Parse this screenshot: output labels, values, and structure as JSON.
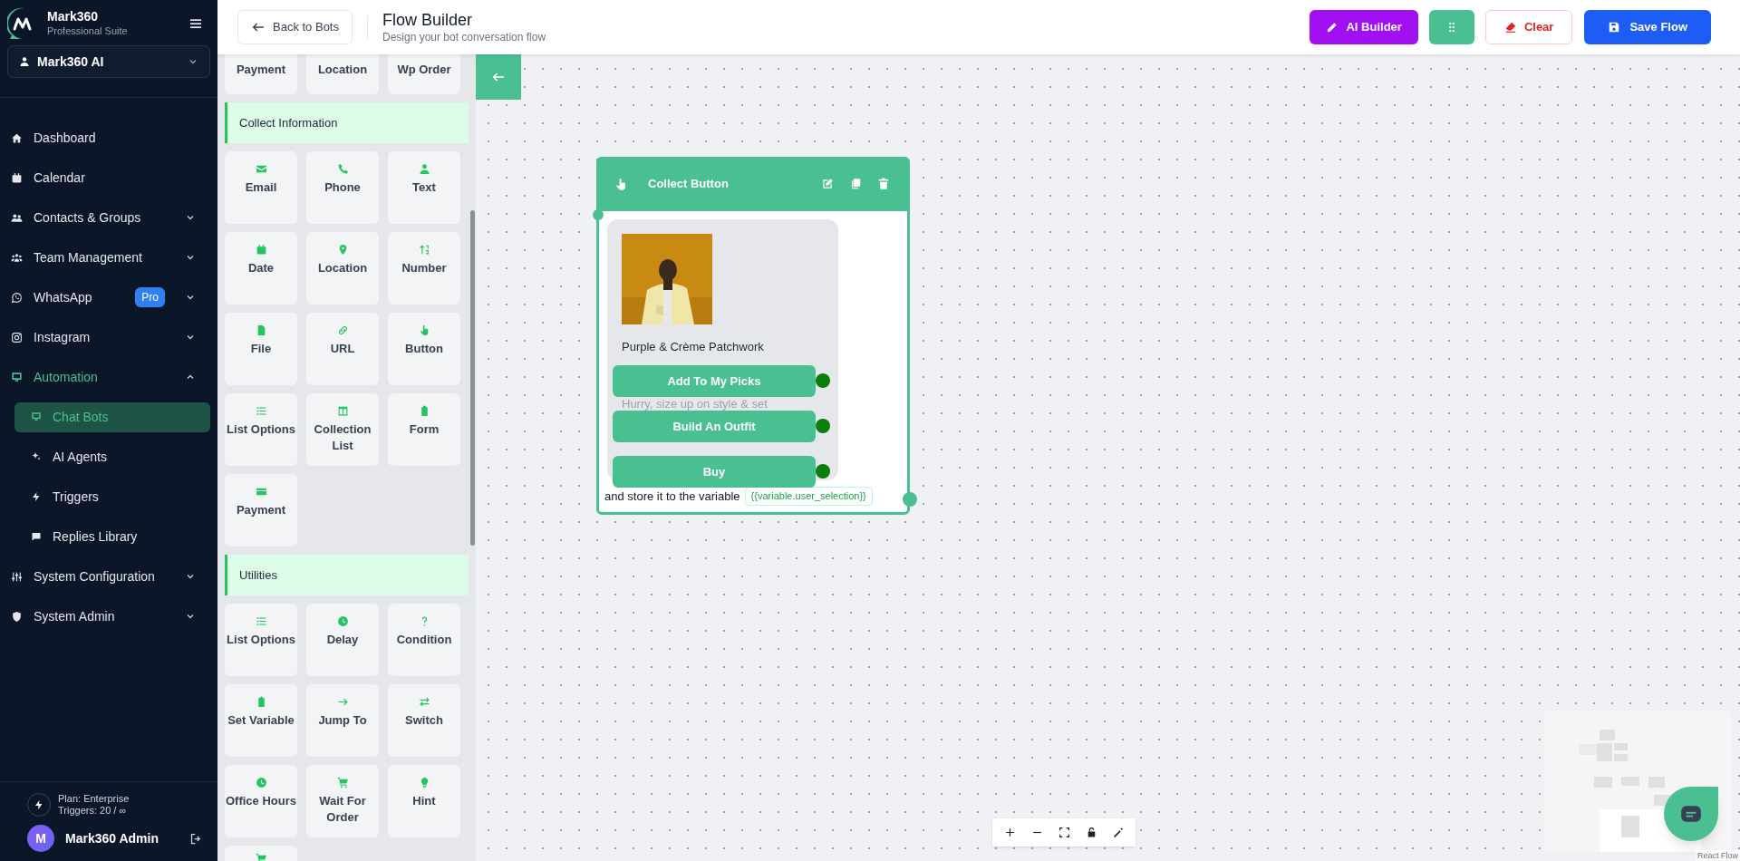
{
  "sidebar": {
    "brand": {
      "name": "Mark360",
      "subtitle": "Professional Suite"
    },
    "workspace": {
      "label": "Mark360 AI"
    },
    "nav": [
      {
        "label": "Dashboard",
        "kind": "link",
        "selected": false
      },
      {
        "label": "Calendar",
        "kind": "link",
        "selected": false
      },
      {
        "label": "Contacts & Groups",
        "kind": "group",
        "expanded": false,
        "selected": false
      },
      {
        "label": "Team Management",
        "kind": "group",
        "expanded": false,
        "selected": false
      },
      {
        "label": "WhatsApp",
        "kind": "group",
        "expanded": false,
        "selected": false,
        "badge": "Pro"
      },
      {
        "label": "Instagram",
        "kind": "group",
        "expanded": false,
        "selected": false
      },
      {
        "label": "Automation",
        "kind": "group",
        "expanded": true,
        "selected": false,
        "children": [
          {
            "label": "Chat Bots",
            "selected": true
          },
          {
            "label": "AI Agents",
            "selected": false
          },
          {
            "label": "Triggers",
            "selected": false
          },
          {
            "label": "Replies Library",
            "selected": false
          }
        ]
      },
      {
        "label": "System Configuration",
        "kind": "group",
        "expanded": false,
        "selected": false
      },
      {
        "label": "System Admin",
        "kind": "group",
        "expanded": false,
        "selected": false
      }
    ],
    "plan": {
      "name": "Plan: Enterprise",
      "triggers": "Triggers: 20 / ∞"
    },
    "user": {
      "initial": "M",
      "name": "Mark360 Admin"
    }
  },
  "topbar": {
    "back": "Back to Bots",
    "title": "Flow Builder",
    "subtitle": "Design your bot conversation flow",
    "actions": [
      {
        "kind": "ai",
        "label": "AI Builder"
      },
      {
        "kind": "layout"
      },
      {
        "kind": "clear",
        "label": "Clear"
      },
      {
        "kind": "save",
        "label": "Save Flow"
      }
    ]
  },
  "palette": {
    "sections": [
      {
        "items": [
          {
            "label": "Payment"
          },
          {
            "label": "Location"
          },
          {
            "label": "Wp Order"
          }
        ]
      },
      {
        "title": "Collect Information",
        "items": [
          {
            "label": "Email"
          },
          {
            "label": "Phone"
          },
          {
            "label": "Text"
          },
          {
            "label": "Date"
          },
          {
            "label": "Location"
          },
          {
            "label": "Number"
          },
          {
            "label": "File"
          },
          {
            "label": "URL"
          },
          {
            "label": "Button"
          },
          {
            "label": "List Options"
          },
          {
            "label": "Collection List"
          },
          {
            "label": "Form"
          },
          {
            "label": "Payment"
          }
        ]
      },
      {
        "title": "Utilities",
        "items": [
          {
            "label": "List Options"
          },
          {
            "label": "Delay"
          },
          {
            "label": "Condition"
          },
          {
            "label": "Set Variable"
          },
          {
            "label": "Jump To"
          },
          {
            "label": "Switch"
          },
          {
            "label": "Office Hours"
          },
          {
            "label": "Wait For Order"
          },
          {
            "label": "Hint"
          }
        ]
      }
    ]
  },
  "node": {
    "title": "Collect Button",
    "message": [
      {
        "text": "Purple & Crème Patchwork",
        "dimmed": false
      },
      {
        "text": "Hurry, size up on style & set",
        "dimmed": true
      }
    ],
    "buttons": [
      "Add To My Picks",
      "Build An Outfit",
      "Buy"
    ],
    "footer": "and store it to the variable",
    "variable": "{{variable.user_selection}}"
  },
  "attribution": "React Flow"
}
